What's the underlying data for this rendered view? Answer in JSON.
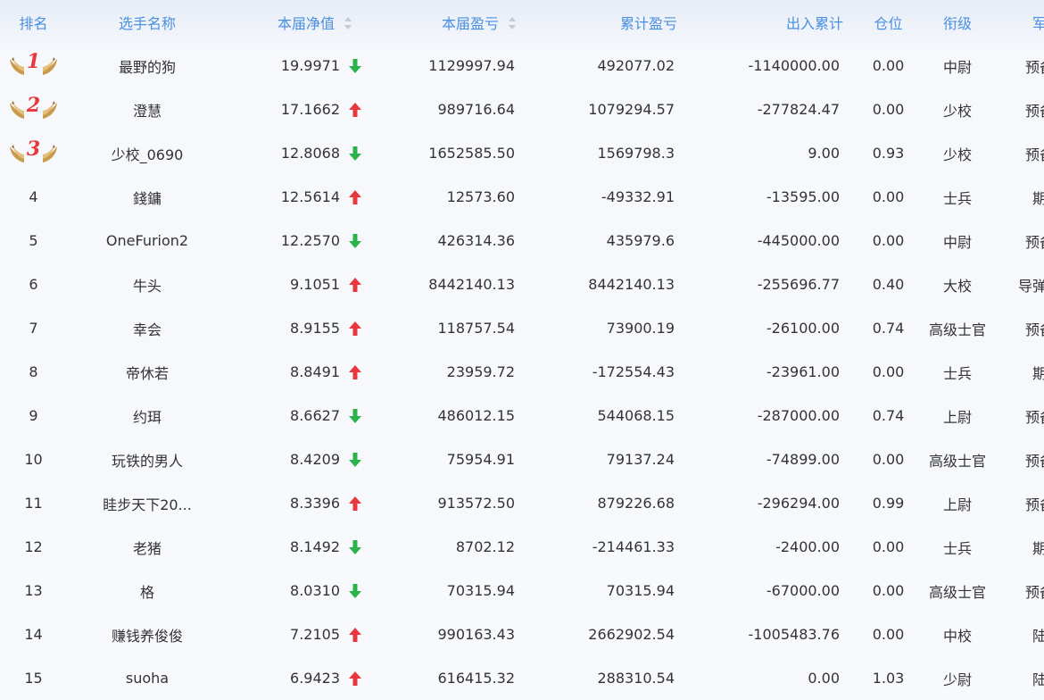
{
  "columns": {
    "rank": "排名",
    "name": "选手名称",
    "nav": "本届净值",
    "pnl": "本届盈亏",
    "cum_pnl": "累计盈亏",
    "flow": "出入累计",
    "position": "仓位",
    "military_rank": "衔级",
    "arm": "军种"
  },
  "colors": {
    "header_text": "#4a90e2",
    "up_arrow": "#e8383d",
    "down_arrow": "#2bb34a",
    "medal_number": "#e8383d",
    "medal_wing": "#c99a4b"
  },
  "rows": [
    {
      "rank": "1",
      "medal": true,
      "name": "最野的狗",
      "nav": "19.9971",
      "trend": "down",
      "pnl": "1129997.94",
      "cum_pnl": "492077.02",
      "flow": "-1140000.00",
      "position": "0.00",
      "military_rank": "中尉",
      "arm": "预备役"
    },
    {
      "rank": "2",
      "medal": true,
      "name": "澄慧",
      "nav": "17.1662",
      "trend": "up",
      "pnl": "989716.64",
      "cum_pnl": "1079294.57",
      "flow": "-277824.47",
      "position": "0.00",
      "military_rank": "少校",
      "arm": "预备役"
    },
    {
      "rank": "3",
      "medal": true,
      "name": "少校_0690",
      "nav": "12.8068",
      "trend": "down",
      "pnl": "1652585.50",
      "cum_pnl": "1569798.3",
      "flow": "9.00",
      "position": "0.93",
      "military_rank": "少校",
      "arm": "预备役"
    },
    {
      "rank": "4",
      "medal": false,
      "name": "錢鏞",
      "nav": "12.5614",
      "trend": "up",
      "pnl": "12573.60",
      "cum_pnl": "-49332.91",
      "flow": "-13595.00",
      "position": "0.00",
      "military_rank": "士兵",
      "arm": "期权"
    },
    {
      "rank": "5",
      "medal": false,
      "name": "OneFurion2",
      "nav": "12.2570",
      "trend": "down",
      "pnl": "426314.36",
      "cum_pnl": "435979.6",
      "flow": "-445000.00",
      "position": "0.00",
      "military_rank": "中尉",
      "arm": "预备役"
    },
    {
      "rank": "6",
      "medal": false,
      "name": "牛头",
      "nav": "9.1051",
      "trend": "up",
      "pnl": "8442140.13",
      "cum_pnl": "8442140.13",
      "flow": "-255696.77",
      "position": "0.40",
      "military_rank": "大校",
      "arm": "导弹部队"
    },
    {
      "rank": "7",
      "medal": false,
      "name": "幸会",
      "nav": "8.9155",
      "trend": "up",
      "pnl": "118757.54",
      "cum_pnl": "73900.19",
      "flow": "-26100.00",
      "position": "0.74",
      "military_rank": "高级士官",
      "arm": "预备役"
    },
    {
      "rank": "8",
      "medal": false,
      "name": "帝休若",
      "nav": "8.8491",
      "trend": "up",
      "pnl": "23959.72",
      "cum_pnl": "-172554.43",
      "flow": "-23961.00",
      "position": "0.00",
      "military_rank": "士兵",
      "arm": "期权"
    },
    {
      "rank": "9",
      "medal": false,
      "name": "约珥",
      "nav": "8.6627",
      "trend": "down",
      "pnl": "486012.15",
      "cum_pnl": "544068.15",
      "flow": "-287000.00",
      "position": "0.74",
      "military_rank": "上尉",
      "arm": "预备役"
    },
    {
      "rank": "10",
      "medal": false,
      "name": "玩铁的男人",
      "nav": "8.4209",
      "trend": "down",
      "pnl": "75954.91",
      "cum_pnl": "79137.24",
      "flow": "-74899.00",
      "position": "0.00",
      "military_rank": "高级士官",
      "arm": "预备役"
    },
    {
      "rank": "11",
      "medal": false,
      "name": "眭步天下20...",
      "nav": "8.3396",
      "trend": "up",
      "pnl": "913572.50",
      "cum_pnl": "879226.68",
      "flow": "-296294.00",
      "position": "0.99",
      "military_rank": "上尉",
      "arm": "预备役"
    },
    {
      "rank": "12",
      "medal": false,
      "name": "老猪",
      "nav": "8.1492",
      "trend": "down",
      "pnl": "8702.12",
      "cum_pnl": "-214461.33",
      "flow": "-2400.00",
      "position": "0.00",
      "military_rank": "士兵",
      "arm": "期权"
    },
    {
      "rank": "13",
      "medal": false,
      "name": "格",
      "nav": "8.0310",
      "trend": "down",
      "pnl": "70315.94",
      "cum_pnl": "70315.94",
      "flow": "-67000.00",
      "position": "0.00",
      "military_rank": "高级士官",
      "arm": "预备役"
    },
    {
      "rank": "14",
      "medal": false,
      "name": "赚钱养俊俊",
      "nav": "7.2105",
      "trend": "up",
      "pnl": "990163.43",
      "cum_pnl": "2662902.54",
      "flow": "-1005483.76",
      "position": "0.00",
      "military_rank": "中校",
      "arm": "陆军"
    },
    {
      "rank": "15",
      "medal": false,
      "name": "suoha",
      "nav": "6.9423",
      "trend": "up",
      "pnl": "616415.32",
      "cum_pnl": "288310.54",
      "flow": "0.00",
      "position": "1.03",
      "military_rank": "少尉",
      "arm": "陆军"
    }
  ]
}
